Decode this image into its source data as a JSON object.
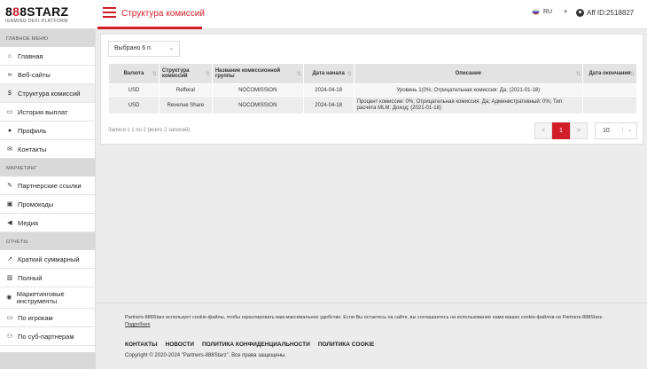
{
  "brand": {
    "logo_prefix": "8",
    "logo_accent": "8",
    "logo_suffix": "8STARZ",
    "logo_sub": "iGAMING DEFI PLATFORM"
  },
  "header": {
    "title": "Структура комиссий",
    "lang": "RU",
    "user": "Aff ID:2518827"
  },
  "sidebar": {
    "sections": [
      "ГЛАВНОЕ МЕНЮ",
      "МАРКЕТИНГ",
      "ОТЧЕТЫ"
    ],
    "main_items": [
      {
        "label": "Главная",
        "icon": "home-icon"
      },
      {
        "label": "Веб-сайты",
        "icon": "link-icon"
      },
      {
        "label": "Структура комиссий",
        "icon": "dollar-icon"
      },
      {
        "label": "История выплат",
        "icon": "wallet-icon"
      },
      {
        "label": "Профиль",
        "icon": "user-icon"
      },
      {
        "label": "Контакты",
        "icon": "mail-icon"
      }
    ],
    "marketing_items": [
      {
        "label": "Партнерские ссылки",
        "icon": "edit-icon"
      },
      {
        "label": "Промокоды",
        "icon": "ticket-icon"
      },
      {
        "label": "Медиа",
        "icon": "megaphone-icon"
      }
    ],
    "report_items": [
      {
        "label": "Краткий суммарный",
        "icon": "chart-icon"
      },
      {
        "label": "Полный",
        "icon": "bar-chart-icon"
      },
      {
        "label": "Маркетинговые инструменты",
        "icon": "palette-icon"
      },
      {
        "label": "По игрокам",
        "icon": "monitor-icon"
      },
      {
        "label": "По суб-партнерам",
        "icon": "group-icon"
      }
    ]
  },
  "toolbar": {
    "column_select": "Выбрано 6 п."
  },
  "table": {
    "headers": [
      "Валюта",
      "Структура комиссий",
      "Название комиссионной группы",
      "Дата начала",
      "Описание",
      "Дата окончания"
    ],
    "rows": [
      [
        "USD",
        "Refferal",
        "NOCOMISSION",
        "2024-04-18",
        "Уровень 1(0%; Отрицательная комиссия: Да; (2021-01-18)",
        ""
      ],
      [
        "USD",
        "Revenue Share",
        "NOCOMISSION",
        "2024-04-18",
        "Процент комиссии: 0%; Отрицательная комиссия: Да; Административный: 0%; Тип расчета MLM: Доход; (2021-01-18)",
        ""
      ]
    ]
  },
  "pagination": {
    "info": "Записи с 1 по 2 (всего 2 записей)",
    "prev": "<",
    "current": "1",
    "next": ">",
    "page_size": "10"
  },
  "footer": {
    "cookie_text": "Partners-888Starz использует cookie-файлы, чтобы гарантировать вам максимальное удобство. Если Вы остаетесь на сайте, вы соглашаетесь на использование нами ваших cookie-файлов на Partners-888Starz.",
    "cookie_link": "Подробнее",
    "links": [
      "КОНТАКТЫ",
      "НОВОСТИ",
      "ПОЛИТИКА КОНФИДЕНЦИАЛЬНОСТИ",
      "ПОЛИТИКА COOKIE"
    ],
    "copyright": "Copyright © 2020-2024 \"Partners-888Starz\". Все права защищены."
  },
  "colors": {
    "accent": "#d11f2a",
    "sidebar_section": "#d9d9d9",
    "header_cell": "#e3e3e3"
  }
}
